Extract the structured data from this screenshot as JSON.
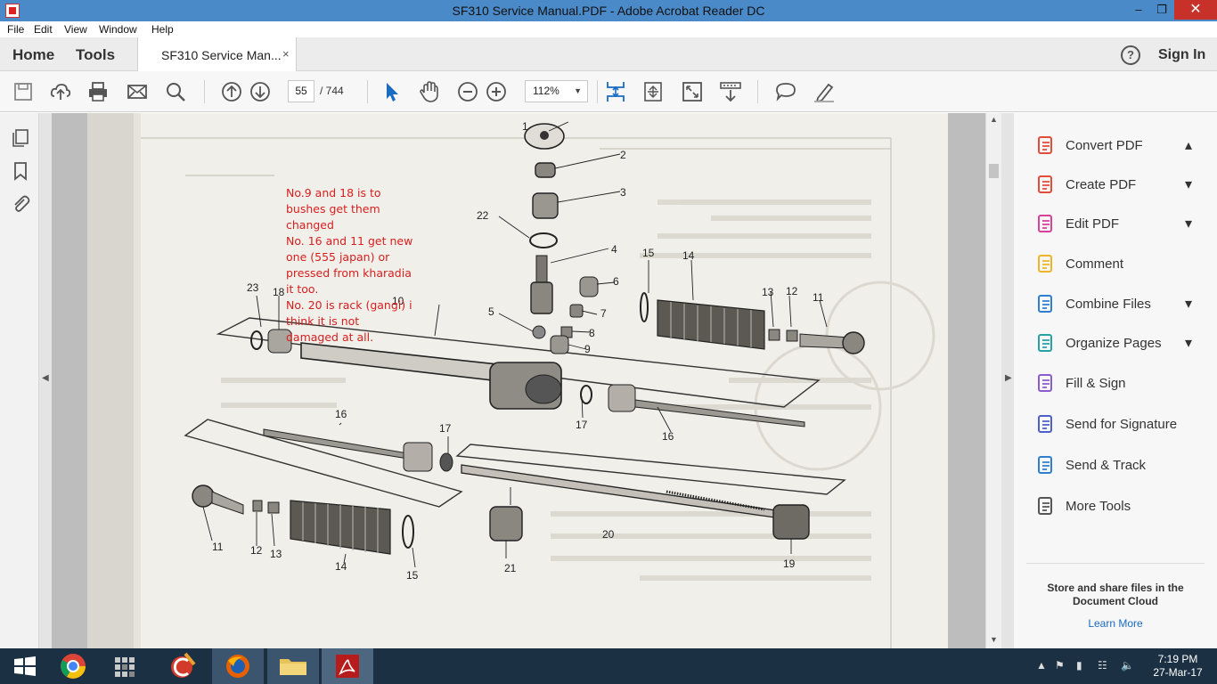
{
  "window": {
    "title": "SF310 Service Manual.PDF - Adobe Acrobat Reader DC",
    "minimize": "–",
    "maximize": "❐",
    "close": "✕"
  },
  "menu": [
    "File",
    "Edit",
    "View",
    "Window",
    "Help"
  ],
  "tabs": {
    "home": "Home",
    "tools": "Tools",
    "document": "SF310 Service Man...",
    "close": "×",
    "help": "?",
    "sign_in": "Sign In"
  },
  "toolbar": {
    "icons": [
      "save-icon",
      "upload-icon",
      "print-icon",
      "email-icon",
      "search-icon",
      "page-up-icon",
      "page-down-icon",
      "select-cursor-icon",
      "hand-icon",
      "zoom-out-icon",
      "zoom-in-icon",
      "fit-page-icon",
      "scroll-mode-icon",
      "full-screen-icon",
      "read-mode-icon",
      "comment-icon",
      "highlight-pen-icon"
    ],
    "page_current": "55",
    "page_total": "/ 744",
    "zoom": "112%",
    "accent": "#1a6bc2"
  },
  "left_pane": {
    "icons": [
      "pages-icon",
      "bookmark-icon",
      "attachment-icon"
    ]
  },
  "document": {
    "annotation_lines": [
      "No.9 and 18 is to",
      "bushes get them",
      "changed",
      "No. 16 and 11 get new",
      "one (555 japan) or",
      "pressed from kharadia",
      "it too.",
      "No. 20 is rack (gangi) i",
      "think it is not",
      "damaged at all."
    ],
    "annotation_color": "#d62020",
    "part_numbers": [
      "1",
      "2",
      "3",
      "4",
      "5",
      "6",
      "7",
      "8",
      "9",
      "10",
      "11",
      "12",
      "13",
      "14",
      "15",
      "16",
      "17",
      "18",
      "19",
      "20",
      "21",
      "22",
      "23",
      "11",
      "12",
      "13",
      "14",
      "15",
      "16",
      "17"
    ]
  },
  "right_pane": {
    "tools": [
      {
        "label": "Convert PDF",
        "icon": "convert-pdf-icon",
        "chevron": "up",
        "color": "#e34b3a"
      },
      {
        "label": "Create PDF",
        "icon": "create-pdf-icon",
        "chevron": "down",
        "color": "#e34b3a"
      },
      {
        "label": "Edit PDF",
        "icon": "edit-pdf-icon",
        "chevron": "down",
        "color": "#d9409a"
      },
      {
        "label": "Comment",
        "icon": "comment-icon",
        "chevron": "",
        "color": "#f0b428"
      },
      {
        "label": "Combine Files",
        "icon": "combine-files-icon",
        "chevron": "down",
        "color": "#2f7fd0"
      },
      {
        "label": "Organize Pages",
        "icon": "organize-pages-icon",
        "chevron": "down",
        "color": "#25a2a6"
      },
      {
        "label": "Fill & Sign",
        "icon": "fill-sign-icon",
        "chevron": "",
        "color": "#8a5cd0"
      },
      {
        "label": "Send for Signature",
        "icon": "send-signature-icon",
        "chevron": "",
        "color": "#4d5fc8"
      },
      {
        "label": "Send & Track",
        "icon": "send-track-icon",
        "chevron": "",
        "color": "#2f7fd0"
      },
      {
        "label": "More Tools",
        "icon": "more-tools-icon",
        "chevron": "",
        "color": "#555555"
      }
    ],
    "cloud_text_line1": "Store and share files in the",
    "cloud_text_line2": "Document Cloud",
    "learn_more": "Learn More"
  },
  "taskbar": {
    "apps": [
      "start-icon",
      "chrome-icon",
      "file-explorer-grid-icon",
      "ccleaner-icon",
      "firefox-icon",
      "folder-icon",
      "acrobat-icon"
    ],
    "time": "7:19 PM",
    "date": "27-Mar-17"
  }
}
